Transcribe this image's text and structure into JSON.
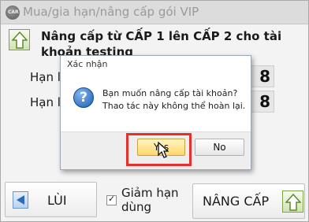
{
  "window": {
    "title": "Mua/gia hạn/nâng cấp gói VIP",
    "app_icon_text": "CAR"
  },
  "header": {
    "message": "Nâng cấp từ CẤP 1 lên CẤP 2 cho tài khoản testing"
  },
  "rows": [
    {
      "label": "Hạn l",
      "value": "8"
    },
    {
      "label": "Hạn l",
      "value": "8"
    }
  ],
  "footer": {
    "back_label": "LÙI",
    "checkbox_label": "Giảm hạn dùng",
    "checkbox_checked": true,
    "upgrade_label": "NÂNG CẤP"
  },
  "dialog": {
    "title": "Xác nhận",
    "icon": "question-icon",
    "message_line1": "Bạn muốn nâng cấp tài khoản?",
    "message_line2": "Thao tác này không thể hoàn lại.",
    "yes_label": "Yes",
    "no_label": "No"
  },
  "colors": {
    "highlight": "#e4312b",
    "yes_button": "#ffd76a",
    "upgrade_arrow": "#7aa34a",
    "back_arrow": "#6e96c7"
  }
}
